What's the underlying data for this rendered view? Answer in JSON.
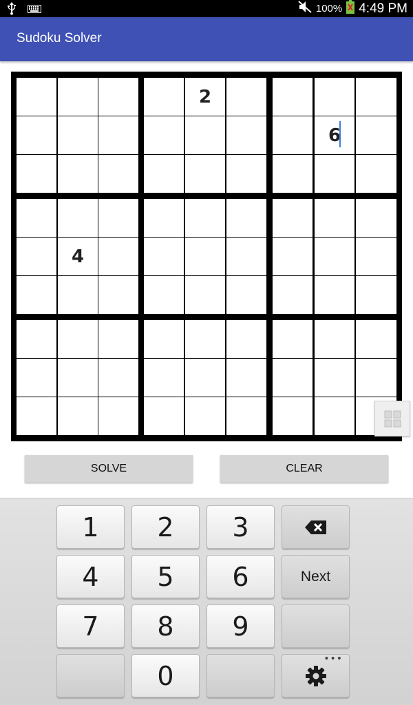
{
  "status_bar": {
    "left_icons": [
      "usb-icon",
      "keyboard-icon"
    ],
    "right_icons": [
      "mute-icon",
      "battery-icon"
    ],
    "battery_percent": "100%",
    "time": "4:49 PM"
  },
  "app_bar": {
    "title": "Sudoku Solver"
  },
  "board": {
    "rows": [
      [
        "",
        "",
        "",
        "",
        "2",
        "",
        "",
        "",
        ""
      ],
      [
        "",
        "",
        "",
        "",
        "",
        "",
        "",
        "6",
        ""
      ],
      [
        "",
        "",
        "",
        "",
        "",
        "",
        "",
        "",
        ""
      ],
      [
        "",
        "",
        "",
        "",
        "",
        "",
        "",
        "",
        ""
      ],
      [
        "",
        "4",
        "",
        "",
        "",
        "",
        "",
        "",
        ""
      ],
      [
        "",
        "",
        "",
        "",
        "",
        "",
        "",
        "",
        ""
      ],
      [
        "",
        "",
        "",
        "",
        "",
        "",
        "",
        "",
        ""
      ],
      [
        "",
        "",
        "",
        "",
        "",
        "",
        "",
        "",
        ""
      ],
      [
        "",
        "",
        "",
        "",
        "",
        "",
        "",
        "",
        ""
      ]
    ],
    "focused_cell": {
      "row": 2,
      "col": 8
    }
  },
  "actions": {
    "solve_label": "SOLVE",
    "clear_label": "CLEAR"
  },
  "keyboard": {
    "keys": [
      [
        "1",
        "2",
        "3",
        "backspace"
      ],
      [
        "4",
        "5",
        "6",
        "Next"
      ],
      [
        "7",
        "8",
        "9",
        ""
      ],
      [
        "",
        "0",
        "",
        "settings"
      ]
    ],
    "next_label": "Next"
  },
  "colors": {
    "app_bar": "#3f51b5",
    "caret": "#3b7fd6"
  }
}
